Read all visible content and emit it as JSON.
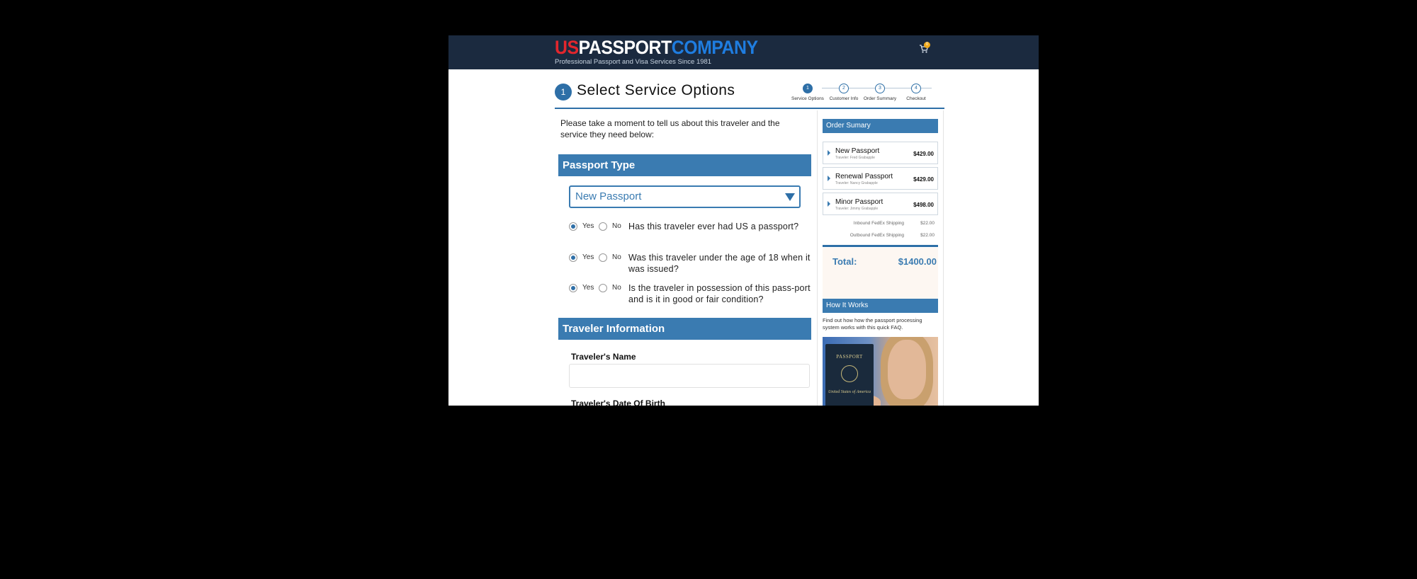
{
  "header": {
    "logo_us": "US",
    "logo_passport": "PASSPORT",
    "logo_company": "COMPANY",
    "tagline": "Professional Passport and Visa Services Since 1981",
    "cart_count": "0"
  },
  "title": {
    "step_number": "1",
    "text": "Select Service Options"
  },
  "stepper": [
    {
      "num": "1",
      "label": "Service Options"
    },
    {
      "num": "2",
      "label": "Customer Info"
    },
    {
      "num": "3",
      "label": "Order Summary"
    },
    {
      "num": "4",
      "label": "Checkout"
    }
  ],
  "intro": "Please take a moment to tell us about this traveler and the service they need below:",
  "passport_type": {
    "heading": "Passport Type",
    "selected": "New Passport"
  },
  "questions": [
    {
      "yes": "Yes",
      "no": "No",
      "text": "Has this traveler ever had US a passport?"
    },
    {
      "yes": "Yes",
      "no": "No",
      "text": "Was this traveler under the age of 18 when it was issued?"
    },
    {
      "yes": "Yes",
      "no": "No",
      "text": "Is the traveler in possession of this pass-port and is it in good or fair condition?"
    }
  ],
  "traveler": {
    "heading": "Traveler Information",
    "name_label": "Traveler's Name",
    "dob_label": "Traveler's Date Of Birth"
  },
  "order_summary": {
    "heading": "Order Sumary",
    "items": [
      {
        "name": "New Passport",
        "sub": "Traveler: Fred Grabapple",
        "price": "$429.00"
      },
      {
        "name": "Renewal Passport",
        "sub": "Traveler: Nancy Grabapple",
        "price": "$429.00"
      },
      {
        "name": "Minor Passport",
        "sub": "Traveler: Jimmy Grabapple",
        "price": "$498.00"
      }
    ],
    "inbound_label": "Inbound FedEx Shipping",
    "inbound_value": "$22.00",
    "outbound_label": "Outbound FedEx Shipping",
    "outbound_value": "$22.00",
    "total_label": "Total:",
    "total_value": "$1400.00"
  },
  "how_it_works": {
    "heading": "How It Works",
    "text": "Find out how how the passport processing system works with this quick FAQ.",
    "book_title": "PASSPORT",
    "book_sub": "United States of America"
  },
  "colors": {
    "header_bg": "#1b2a3f",
    "accent": "#3a7bb1",
    "logo_red": "#e3262d",
    "logo_blue": "#1f7de0"
  }
}
